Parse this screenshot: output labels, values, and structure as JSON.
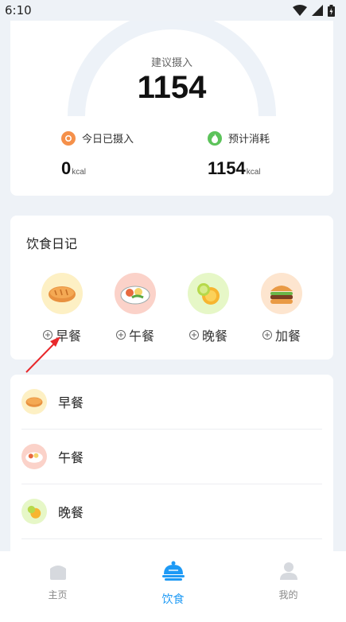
{
  "status_bar": {
    "time": "6:10"
  },
  "intake": {
    "suggest_label": "建议摄入",
    "suggest_value": "1154",
    "today_label": "今日已摄入",
    "today_value": "0",
    "burn_label": "预计消耗",
    "burn_value": "1154",
    "unit": "kcal"
  },
  "diary": {
    "title": "饮食日记",
    "meals": [
      {
        "label": "早餐",
        "icon": "bread-icon",
        "bg": "#fdf0c4"
      },
      {
        "label": "午餐",
        "icon": "lunch-plate-icon",
        "bg": "#fbd2c9"
      },
      {
        "label": "晚餐",
        "icon": "orange-icon",
        "bg": "#e6f7c7"
      },
      {
        "label": "加餐",
        "icon": "burger-icon",
        "bg": "#fde5cf"
      }
    ]
  },
  "meal_list": [
    {
      "label": "早餐"
    },
    {
      "label": "午餐"
    },
    {
      "label": "晚餐"
    }
  ],
  "tabs": [
    {
      "label": "主页"
    },
    {
      "label": "饮食"
    },
    {
      "label": "我的"
    }
  ],
  "colors": {
    "accent": "#1e9af5",
    "gauge_track": "#edf2f8",
    "intake_dot": "#f5904a",
    "burn_dot": "#5cc35a"
  }
}
